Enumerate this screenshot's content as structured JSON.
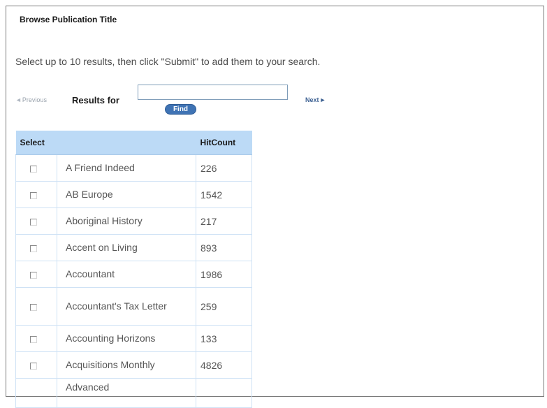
{
  "title": "Browse Publication Title",
  "instructions": "Select up to 10 results, then click \"Submit\" to add them to your search.",
  "nav": {
    "prev_arrow": "◄",
    "prev_label": "Previous",
    "next_label": "Next",
    "next_arrow": "►"
  },
  "search": {
    "label": "Results for",
    "value": "",
    "find_label": "Find"
  },
  "table": {
    "headers": {
      "select": "Select",
      "title": "",
      "hitcount": "HitCount"
    },
    "rows": [
      {
        "title": "A Friend Indeed",
        "hitcount": "226"
      },
      {
        "title": "AB Europe",
        "hitcount": "1542"
      },
      {
        "title": "Aboriginal History",
        "hitcount": "217"
      },
      {
        "title": "Accent on Living",
        "hitcount": "893"
      },
      {
        "title": "Accountant",
        "hitcount": "1986"
      },
      {
        "title": "Accountant's Tax Letter",
        "hitcount": "259"
      },
      {
        "title": "Accounting Horizons",
        "hitcount": "133"
      },
      {
        "title": "Acquisitions Monthly",
        "hitcount": "4826"
      },
      {
        "title": "Advanced",
        "hitcount": ""
      }
    ]
  }
}
